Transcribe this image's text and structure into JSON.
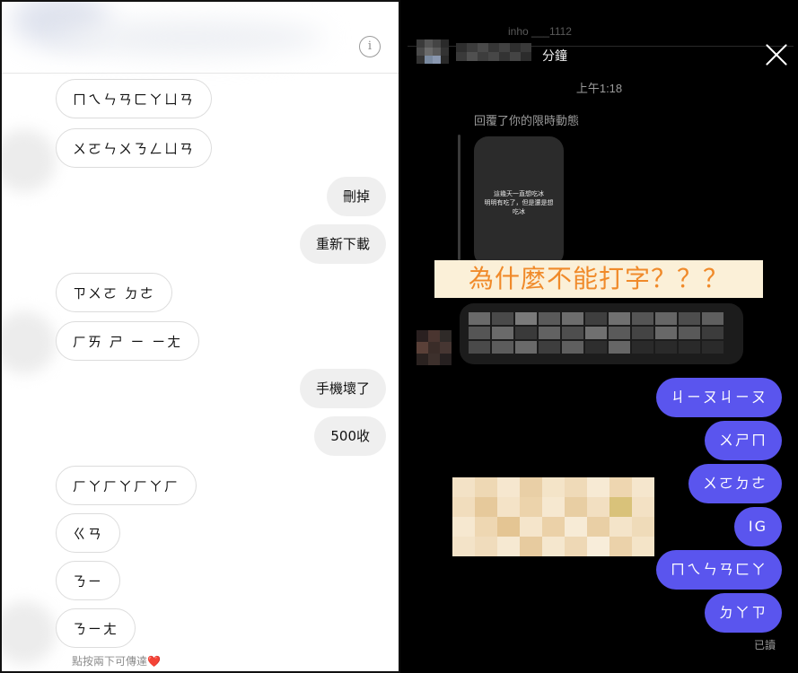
{
  "left_panel": {
    "info_icon": "info-icon",
    "messages": [
      {
        "dir": "in",
        "text": "ㄇㄟㄣㄢㄈㄚㄩㄢ"
      },
      {
        "dir": "in",
        "text": "ㄨㄛㄣㄨㄋㄥㄩㄢ"
      },
      {
        "dir": "out",
        "text": "刪掉"
      },
      {
        "dir": "out",
        "text": "重新下載"
      },
      {
        "dir": "in",
        "text": "ㄗㄨㄛ ㄉㄜ"
      },
      {
        "dir": "in",
        "text": "ㄏㄞ ㄕ ㄧ ㄧㄤ"
      },
      {
        "dir": "out",
        "text": "手機壞了"
      },
      {
        "dir": "out",
        "text": "500收"
      },
      {
        "dir": "in",
        "text": "ㄏㄚㄏㄚㄏㄚㄏ"
      },
      {
        "dir": "in",
        "text": "ㄍㄢ"
      },
      {
        "dir": "in",
        "text": "ㄋㄧ"
      },
      {
        "dir": "in",
        "text": "ㄋㄧㄤ"
      }
    ],
    "seen_note": "點按兩下可傳達",
    "seen_heart": "❤️"
  },
  "right_panel": {
    "top_faint_text": "inho ___1112",
    "active_minutes": "分鐘",
    "timestamp": "上午1:18",
    "replied_note": "回覆了你的限時動態",
    "story_text_line1": "這幾天一直想吃冰",
    "story_text_line2": "明明有吃了，但是還是想",
    "story_text_line3": "吃冰",
    "caption": "為什麼不能打字？？？",
    "messages": [
      "ㄐㄧㄡㄐㄧㄡ",
      "ㄨㄕㄇ",
      "ㄨㄛㄉㄜ",
      "IG",
      "ㄇㄟㄣㄢㄈㄚ",
      "ㄉㄚㄗ"
    ],
    "read_receipt": "已讀",
    "colors": {
      "bubble": "#5a55ee",
      "caption_bg": "#fbf0d8",
      "caption_text": "#f08a2a"
    }
  }
}
